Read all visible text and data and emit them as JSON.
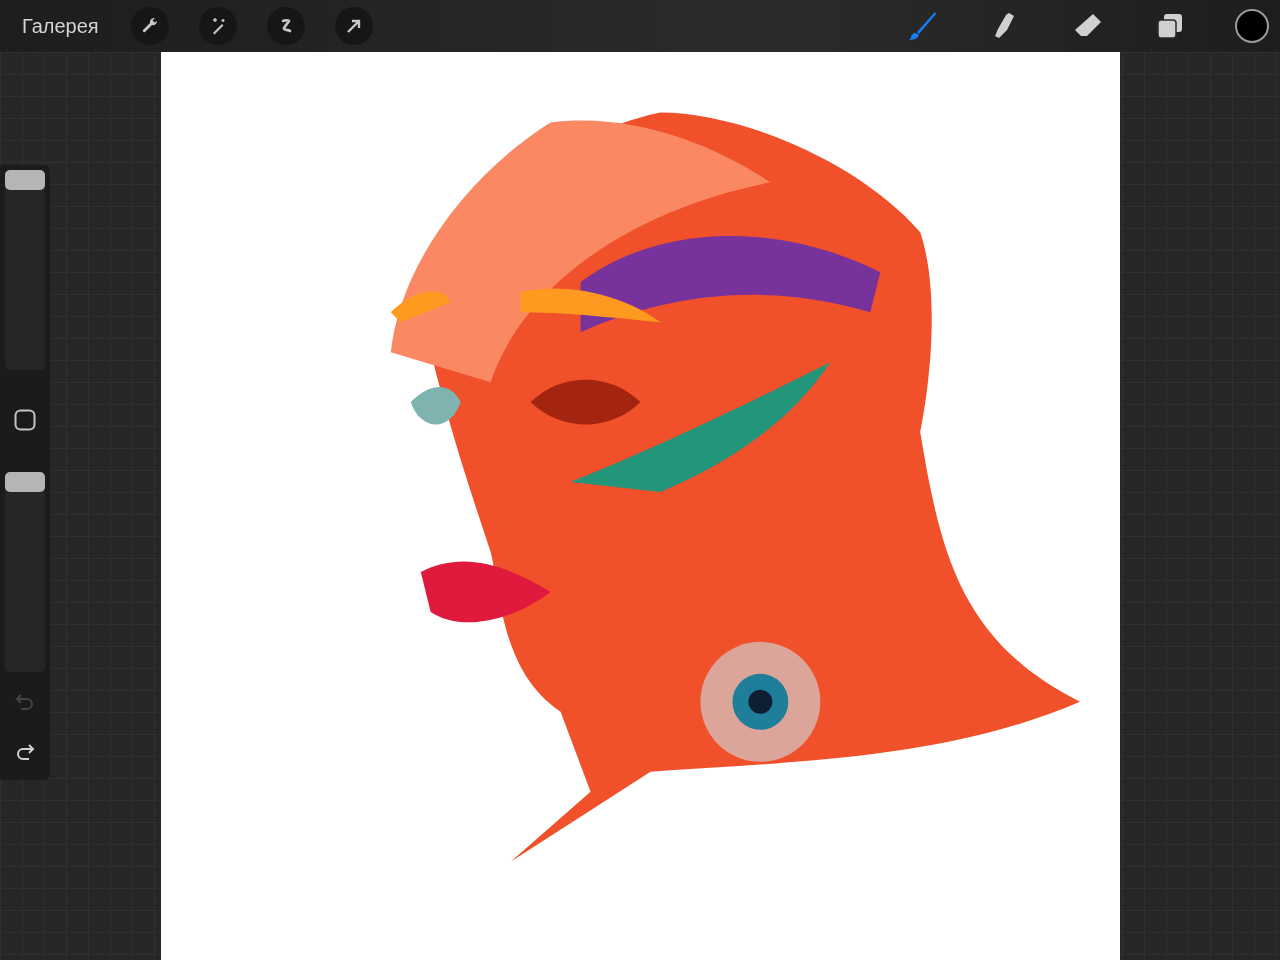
{
  "top_bar": {
    "gallery_label": "Галерея",
    "actions": [
      {
        "kind": "wrench"
      },
      {
        "kind": "adjust"
      },
      {
        "kind": "select"
      },
      {
        "kind": "transform"
      }
    ],
    "tools": [
      {
        "kind": "brush",
        "selected": true
      },
      {
        "kind": "smudge",
        "selected": false
      },
      {
        "kind": "eraser",
        "selected": false
      }
    ]
  },
  "sidebar": {
    "size_slider": {
      "level": 1
    },
    "opacity_slider": {
      "level": 1
    },
    "undo": {
      "disabled": true
    },
    "redo": {
      "disabled": false
    }
  }
}
